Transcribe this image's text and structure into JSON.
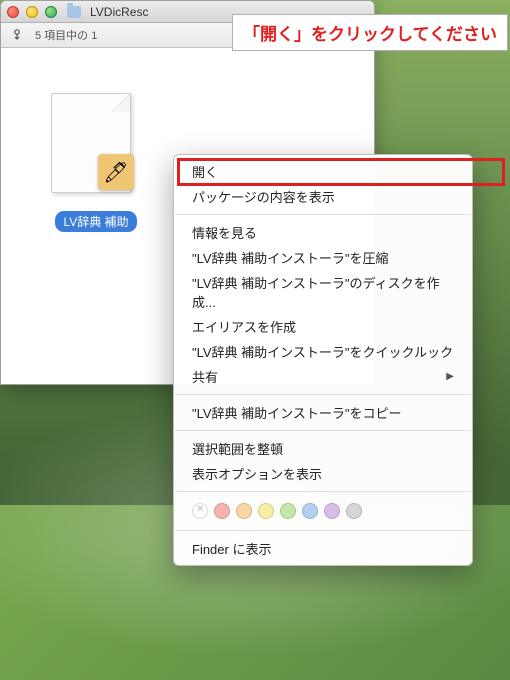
{
  "instruction": "「開く」をクリックしてください",
  "window": {
    "title": "LVDicResc",
    "status": "5 項目中の 1"
  },
  "file": {
    "label": "LV辞典 補助"
  },
  "menu": {
    "open": "開く",
    "packageContents": "パッケージの内容を表示",
    "getInfo": "情報を見る",
    "compress": "\"LV辞典 補助インストーラ\"を圧縮",
    "burnDisc": "\"LV辞典 補助インストーラ\"のディスクを作成...",
    "makeAlias": "エイリアスを作成",
    "quickLook": "\"LV辞典 補助インストーラ\"をクイックルック",
    "share": "共有",
    "copy": "\"LV辞典 補助インストーラ\"をコピー",
    "cleanUpSelection": "選択範囲を整頓",
    "viewOptions": "表示オプションを表示",
    "revealInFinder": "Finder に表示"
  }
}
